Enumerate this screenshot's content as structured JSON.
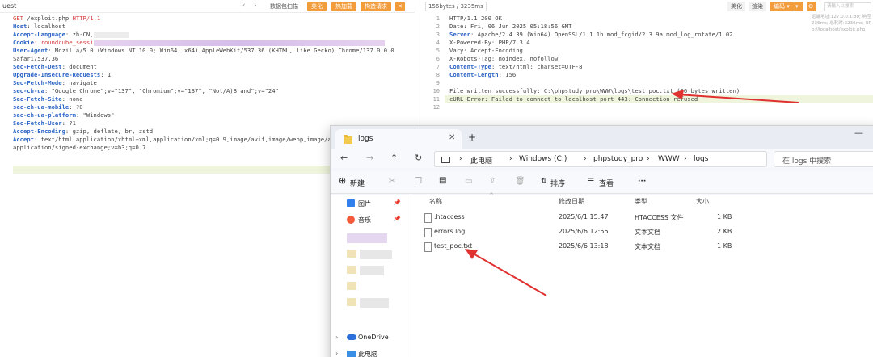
{
  "left": {
    "title": "uest",
    "nav_prev": "‹",
    "nav_next": "›",
    "btn_packet_scan": "数据包扫描",
    "btn_beautify": "美化",
    "btn_hot_load": "热加载",
    "btn_construct_request": "构造请求",
    "btn_close": "✕",
    "request_line": {
      "method": "GET ",
      "path": "/exploit.php ",
      "proto": "HTTP/1.1"
    },
    "headers": [
      {
        "k": "Host",
        "v": ": localhost"
      },
      {
        "k": "Accept-Language",
        "v": ": zh-CN,"
      },
      {
        "k": "Cookie",
        "v": ": roundcube_sessi"
      },
      {
        "k": "User-Agent",
        "v": ": Mozilla/5.0 (Windows NT 10.0; Win64; x64) AppleWebKit/537.36 (KHTML, like Gecko) Chrome/137.0.0.0"
      },
      {
        "k": "",
        "v": "Safari/537.36"
      },
      {
        "k": "Sec-Fetch-Dest",
        "v": ": document"
      },
      {
        "k": "Upgrade-Insecure-Requests",
        "v": ": 1"
      },
      {
        "k": "Sec-Fetch-Mode",
        "v": ": navigate"
      },
      {
        "k": "sec-ch-ua",
        "v": ": \"Google Chrome\";v=\"137\", \"Chromium\";v=\"137\", \"Not/A)Brand\";v=\"24\""
      },
      {
        "k": "Sec-Fetch-Site",
        "v": ": none"
      },
      {
        "k": "sec-ch-ua-mobile",
        "v": ": ?0"
      },
      {
        "k": "sec-ch-ua-platform",
        "v": ": \"Windows\""
      },
      {
        "k": "Sec-Fetch-User",
        "v": ": ?1"
      },
      {
        "k": "Accept-Encoding",
        "v": ": gzip, deflate, br, zstd"
      },
      {
        "k": "Accept",
        "v": ": text/html,application/xhtml+xml,application/xml;q=0.9,image/avif,image/webp,image/ap"
      },
      {
        "k": "",
        "v": "application/signed-exchange;v=b3;q=0.7"
      }
    ]
  },
  "right": {
    "size_label": "156bytes / 3235ms",
    "tab_beautify": "美化",
    "tab_render": "渲染",
    "tab_encoding": "编码 ▾",
    "lines": [
      "1",
      "2",
      "3",
      "4",
      "5",
      "6",
      "7",
      "8",
      "9",
      "10",
      "11",
      "12"
    ],
    "response": [
      {
        "k": "",
        "v": "HTTP/1.1 200 OK"
      },
      {
        "k": "",
        "v": "Date: Fri, 06 Jun 2025 05:18:56 GMT"
      },
      {
        "k": "Server",
        "v": ": Apache/2.4.39 (Win64) OpenSSL/1.1.1b mod_fcgid/2.3.9a mod_log_rotate/1.02"
      },
      {
        "k": "",
        "v": "X-Powered-By: PHP/7.3.4"
      },
      {
        "k": "",
        "v": "Vary: Accept-Encoding"
      },
      {
        "k": "",
        "v": "X-Robots-Tag: noindex, nofollow"
      },
      {
        "k": "Content-Type",
        "v": ": text/html; charset=UTF-8"
      },
      {
        "k": "Content-Length",
        "v": ": 156"
      },
      {
        "k": "",
        "v": ""
      },
      {
        "k": "",
        "v": "File written successfully: C:\\phpstudy_pro\\WWW\\logs\\test_poc.txt (56 bytes written)"
      },
      {
        "k": "",
        "v": "cURL Error: Failed to connect to localhost port 443: Connection refused"
      },
      {
        "k": "",
        "v": ""
      }
    ],
    "side_info": [
      "远端地址:127.0.0.1:80; 响应",
      "236ms; 总耗时:3236ms; UR",
      "p://localhost/exploit.php"
    ],
    "side_search": "请输入以搜索"
  },
  "explorer": {
    "tab_title": "logs",
    "tab_close": "✕",
    "new_tab": "+",
    "minimize": "—",
    "nav_back": "←",
    "nav_forward": "→",
    "nav_up": "↑",
    "nav_refresh": "↻",
    "breadcrumb": [
      "此电脑",
      "Windows (C:)",
      "phpstudy_pro",
      "WWW",
      "logs"
    ],
    "search_placeholder": "在 logs 中搜索",
    "toolbar": {
      "new": "新建",
      "sort": "排序",
      "view": "查看",
      "more": "···"
    },
    "sidebar": [
      {
        "label": "图片",
        "icon": "image-icon"
      },
      {
        "label": "音乐",
        "icon": "music-icon"
      },
      {
        "label": "OneDrive",
        "icon": "cloud-icon"
      },
      {
        "label": "此电脑",
        "icon": "computer-icon"
      }
    ],
    "columns": [
      "名称",
      "修改日期",
      "类型",
      "大小"
    ],
    "files": [
      {
        "name": ".htaccess",
        "date": "2025/6/1 15:47",
        "type": "HTACCESS 文件",
        "size": "1 KB"
      },
      {
        "name": "errors.log",
        "date": "2025/6/6 12:55",
        "type": "文本文档",
        "size": "2 KB"
      },
      {
        "name": "test_poc.txt",
        "date": "2025/6/6 13:18",
        "type": "文本文档",
        "size": "1 KB"
      }
    ]
  },
  "colors": {
    "accent_orange": "#f39c3c",
    "header_blue": "#2a63c6",
    "error_red": "#d63a3a",
    "arrow_red": "#e03030"
  }
}
